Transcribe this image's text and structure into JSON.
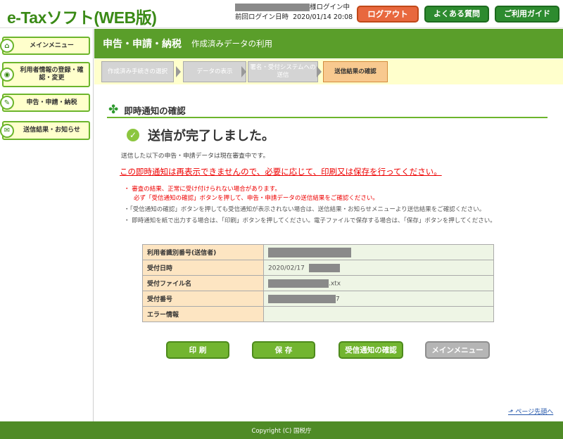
{
  "header": {
    "logo": "e-Taxソフト(WEB版)",
    "login_suffix": "様ログイン中",
    "last_login_label": "前回ログイン日時",
    "last_login_value": "2020/01/14 20:08",
    "logout_label": "ログアウト",
    "faq_label": "よくある質問",
    "guide_label": "ご利用ガイド"
  },
  "sidebar": {
    "items": [
      {
        "label": "メインメニュー",
        "icon": "home-icon"
      },
      {
        "label": "利用者情報の登録・確認・変更",
        "icon": "user-icon"
      },
      {
        "label": "申告・申請・納税",
        "icon": "document-icon"
      },
      {
        "label": "送信結果・お知らせ",
        "icon": "mail-icon"
      }
    ]
  },
  "titlebar": {
    "main": "申告・申請・納税",
    "sub": "作成済みデータの利用"
  },
  "steps": [
    {
      "label": "作成済み手続きの選択"
    },
    {
      "label": "データの表示"
    },
    {
      "label": "署名・受付システムへの送信"
    },
    {
      "label": "送信結果の確認"
    }
  ],
  "content": {
    "section_title": "即時通知の確認",
    "done_message": "送信が完了しました。",
    "status_text": "送信した以下の申告・申請データは現在審査中です。",
    "warning_text": "この即時通知は再表示できませんので、必要に応じて、印刷又は保存を行ってください。",
    "notes": [
      "・ 審査の結果、正常に受け付けられない場合があります。",
      "必ず「受信通知の確認」ボタンを押して、申告・申請データの送信結果をご確認ください。",
      "・「受信通知の確認」ボタンを押しても受信通知が表示されない場合は、送信結果・お知らせメニューより送信結果をご確認ください。",
      "・ 即時通知を紙で出力する場合は、「印刷」ボタンを押してください。電子ファイルで保存する場合は、「保存」ボタンを押してください。"
    ]
  },
  "table": {
    "rows": [
      {
        "key": "利用者識別番号(送信者)",
        "value": ""
      },
      {
        "key": "受付日時",
        "value": "2020/02/17"
      },
      {
        "key": "受付ファイル名",
        "value": ".xtx"
      },
      {
        "key": "受付番号",
        "value": "7"
      },
      {
        "key": "エラー情報",
        "value": ""
      }
    ]
  },
  "actions": {
    "print": "印 刷",
    "save": "保 存",
    "receipt": "受信通知の確認",
    "main_menu": "メインメニュー"
  },
  "page_top": "ページ先頭へ",
  "footer": "Copyright (C) 国税庁",
  "colors": {
    "brand_green": "#5a9e2a",
    "logout_orange": "#e8683e",
    "warning_red": "#e00000"
  }
}
